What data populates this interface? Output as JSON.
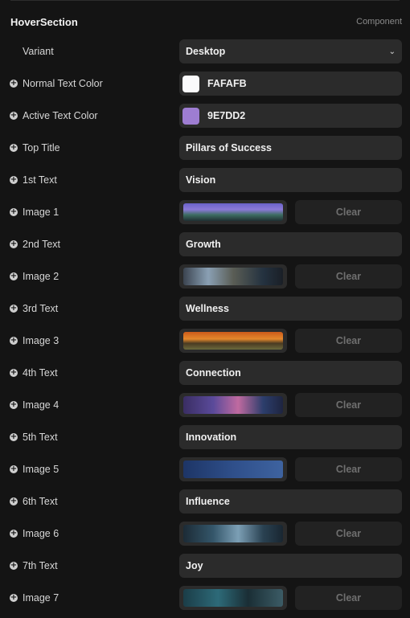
{
  "section": {
    "title": "HoverSection",
    "tag": "Component"
  },
  "variant": {
    "label": "Variant",
    "value": "Desktop"
  },
  "normal_text_color": {
    "label": "Normal Text Color",
    "value": "FAFAFB",
    "swatch": "#FAFAFB"
  },
  "active_text_color": {
    "label": "Active Text Color",
    "value": "9E7DD2",
    "swatch": "#9E7DD2"
  },
  "top_title": {
    "label": "Top Title",
    "value": "Pillars of Success"
  },
  "texts": [
    {
      "label": "1st Text",
      "value": "Vision"
    },
    {
      "label": "2nd Text",
      "value": "Growth"
    },
    {
      "label": "3rd Text",
      "value": "Wellness"
    },
    {
      "label": "4th Text",
      "value": "Connection"
    },
    {
      "label": "5th Text",
      "value": "Innovation"
    },
    {
      "label": "6th Text",
      "value": "Influence"
    },
    {
      "label": "7th Text",
      "value": "Joy"
    }
  ],
  "images": [
    {
      "label": "Image 1",
      "clear_label": "Clear"
    },
    {
      "label": "Image 2",
      "clear_label": "Clear"
    },
    {
      "label": "Image 3",
      "clear_label": "Clear"
    },
    {
      "label": "Image 4",
      "clear_label": "Clear"
    },
    {
      "label": "Image 5",
      "clear_label": "Clear"
    },
    {
      "label": "Image 6",
      "clear_label": "Clear"
    },
    {
      "label": "Image 7",
      "clear_label": "Clear"
    }
  ]
}
